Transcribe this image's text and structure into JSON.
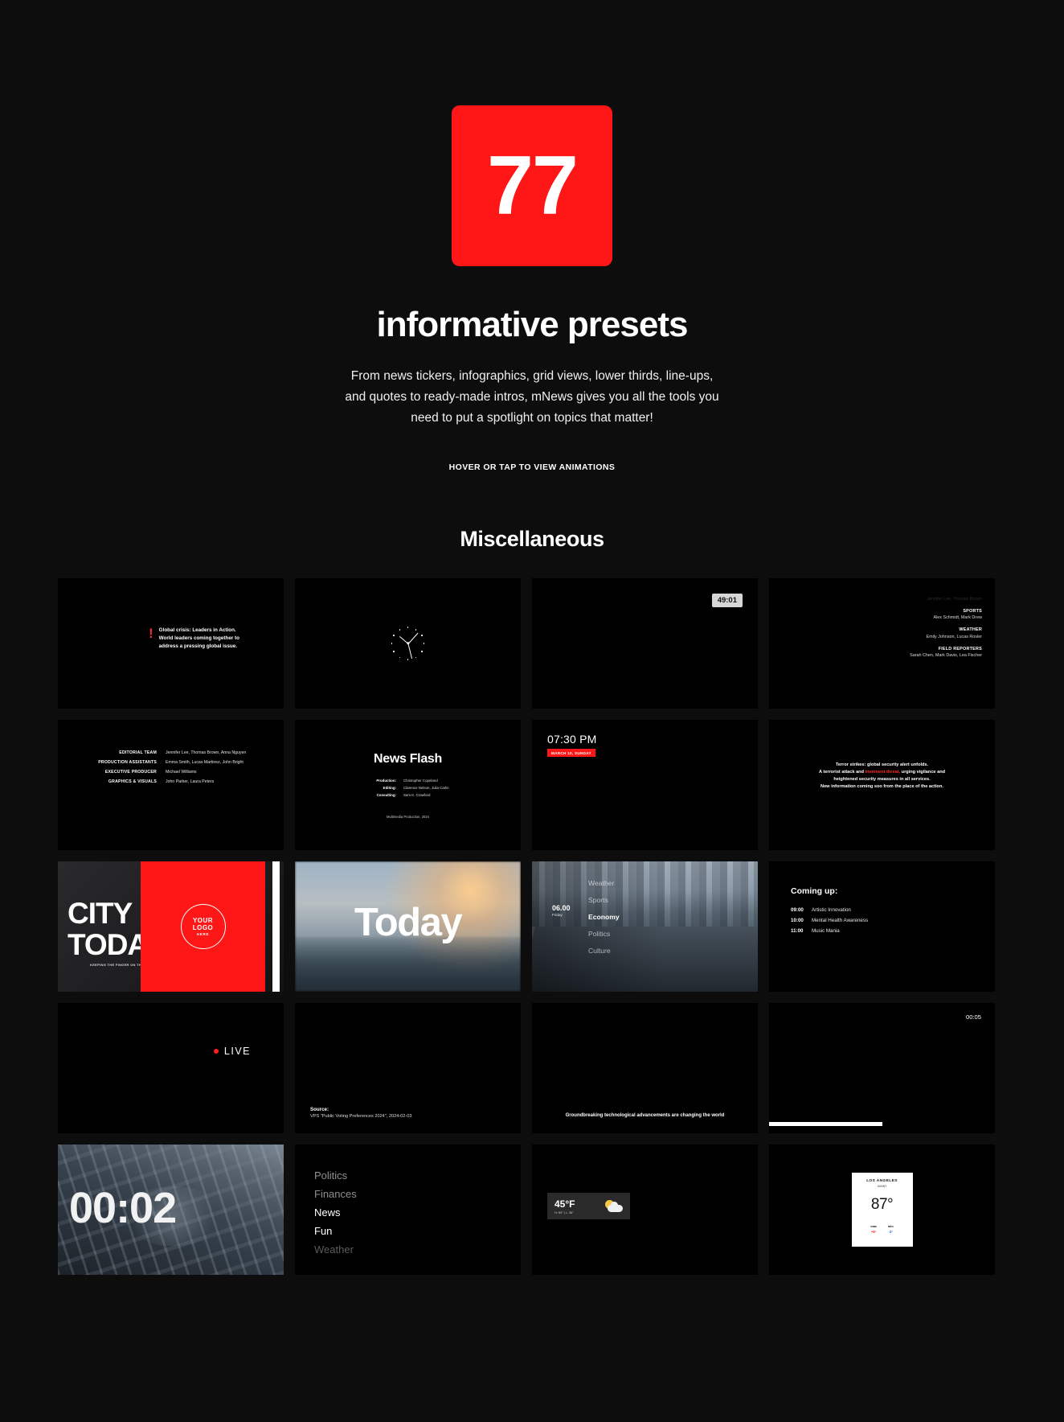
{
  "hero": {
    "badge_number": "77",
    "badge_color": "#ff1616",
    "title": "informative presets",
    "subtitle": "From news tickers, infographics, grid views, lower thirds, line-ups, and quotes to ready-made intros, mNews gives you all the tools you need to put a spotlight on topics that matter!",
    "hint": "HOVER OR TAP TO VIEW ANIMATIONS"
  },
  "section": {
    "title": "Miscellaneous"
  },
  "cards": {
    "alert": {
      "bang": "!",
      "line1": "Global crisis: Leaders in Action.",
      "line2": "World leaders coming together to",
      "line3": "address a pressing global issue."
    },
    "timer": {
      "value": "49:01"
    },
    "roles": [
      {
        "label": "SPORTS",
        "names": "Alex Schmidt, Mark Drew"
      },
      {
        "label": "WEATHER",
        "names": "Emily Johnson, Lucas Rosler"
      },
      {
        "label": "FIELD REPORTERS",
        "names": "Sarah Chen, Mark Davis, Lea Fischer"
      }
    ],
    "editorial": [
      {
        "role": "EDITORIAL TEAM",
        "names": "Jennifer Lee, Thomas Brown, Anna Nguyen"
      },
      {
        "role": "PRODUCTION ASSISTANTS",
        "names": "Emma Smith, Lucas Martinez, John Bright"
      },
      {
        "role": "EXECUTIVE PRODUCER",
        "names": "Michael Williams"
      },
      {
        "role": "GRAPHICS & VISUALS",
        "names": "John Parker, Laura Peters"
      }
    ],
    "newsflash": {
      "title": "News Flash",
      "rows": [
        {
          "role": "Production:",
          "names": "Christopher Copeland"
        },
        {
          "role": "Editing:",
          "names": "Clarence Nelson, Julia Carlin"
        },
        {
          "role": "Consulting:",
          "names": "Sam K. Crawford"
        }
      ],
      "footer": "Multimedia Production, 2024"
    },
    "timeofday": {
      "time": "07:30 PM",
      "date": "MARCH 10, SUNDAY"
    },
    "terror": {
      "l1": "Terror strikes: global security alert unfolds.",
      "l2a": "A terrorist attack and ",
      "l2hl": "imminent threat,",
      "l2b": " urging vigilance and",
      "l3": "heightened security measures in all services.",
      "l4": "New information coming soo from the place of the action."
    },
    "logoreveal": {
      "big_line1": "CITY",
      "big_line2": "TODAY",
      "caption": "KEEPING THE FINGER ON THE CITY'S PULSE",
      "logo_l1": "YOUR",
      "logo_l2": "LOGO",
      "logo_l3": "HERE"
    },
    "today": {
      "word": "Today"
    },
    "citymenu": {
      "time": "06.00",
      "day": "Friday",
      "items": [
        "Weather",
        "Sports",
        "Economy",
        "Politics",
        "Culture"
      ],
      "active": "Economy"
    },
    "comingup": {
      "title": "Coming up:",
      "rows": [
        {
          "time": "09:00",
          "name": "Artistic Innovation"
        },
        {
          "time": "10:00",
          "name": "Mental Health Awareness"
        },
        {
          "time": "11:00",
          "name": "Music Mania"
        }
      ]
    },
    "live": {
      "label": "LIVE"
    },
    "source": {
      "heading": "Source:",
      "detail": "VPS \"Public Voting Preferences 2024\", 2024-02-03"
    },
    "ticker": {
      "text": "Groundbreaking technological advancements are changing the world"
    },
    "progress": {
      "time": "00:05",
      "percent": 50
    },
    "countdown": {
      "value": "00:02"
    },
    "topics": {
      "items": [
        "Politics",
        "Finances",
        "News",
        "Fun",
        "Weather"
      ],
      "active": "News"
    },
    "weatherpill": {
      "temp": "45°F",
      "detail": "H: 50° | L: 36°"
    },
    "weathercard": {
      "city": "LOS ANGELES",
      "condition": "SUNNY",
      "temp": "87°",
      "max_label": "max",
      "max_value": "+6°",
      "min_label": "min",
      "min_value": "-3°"
    }
  }
}
